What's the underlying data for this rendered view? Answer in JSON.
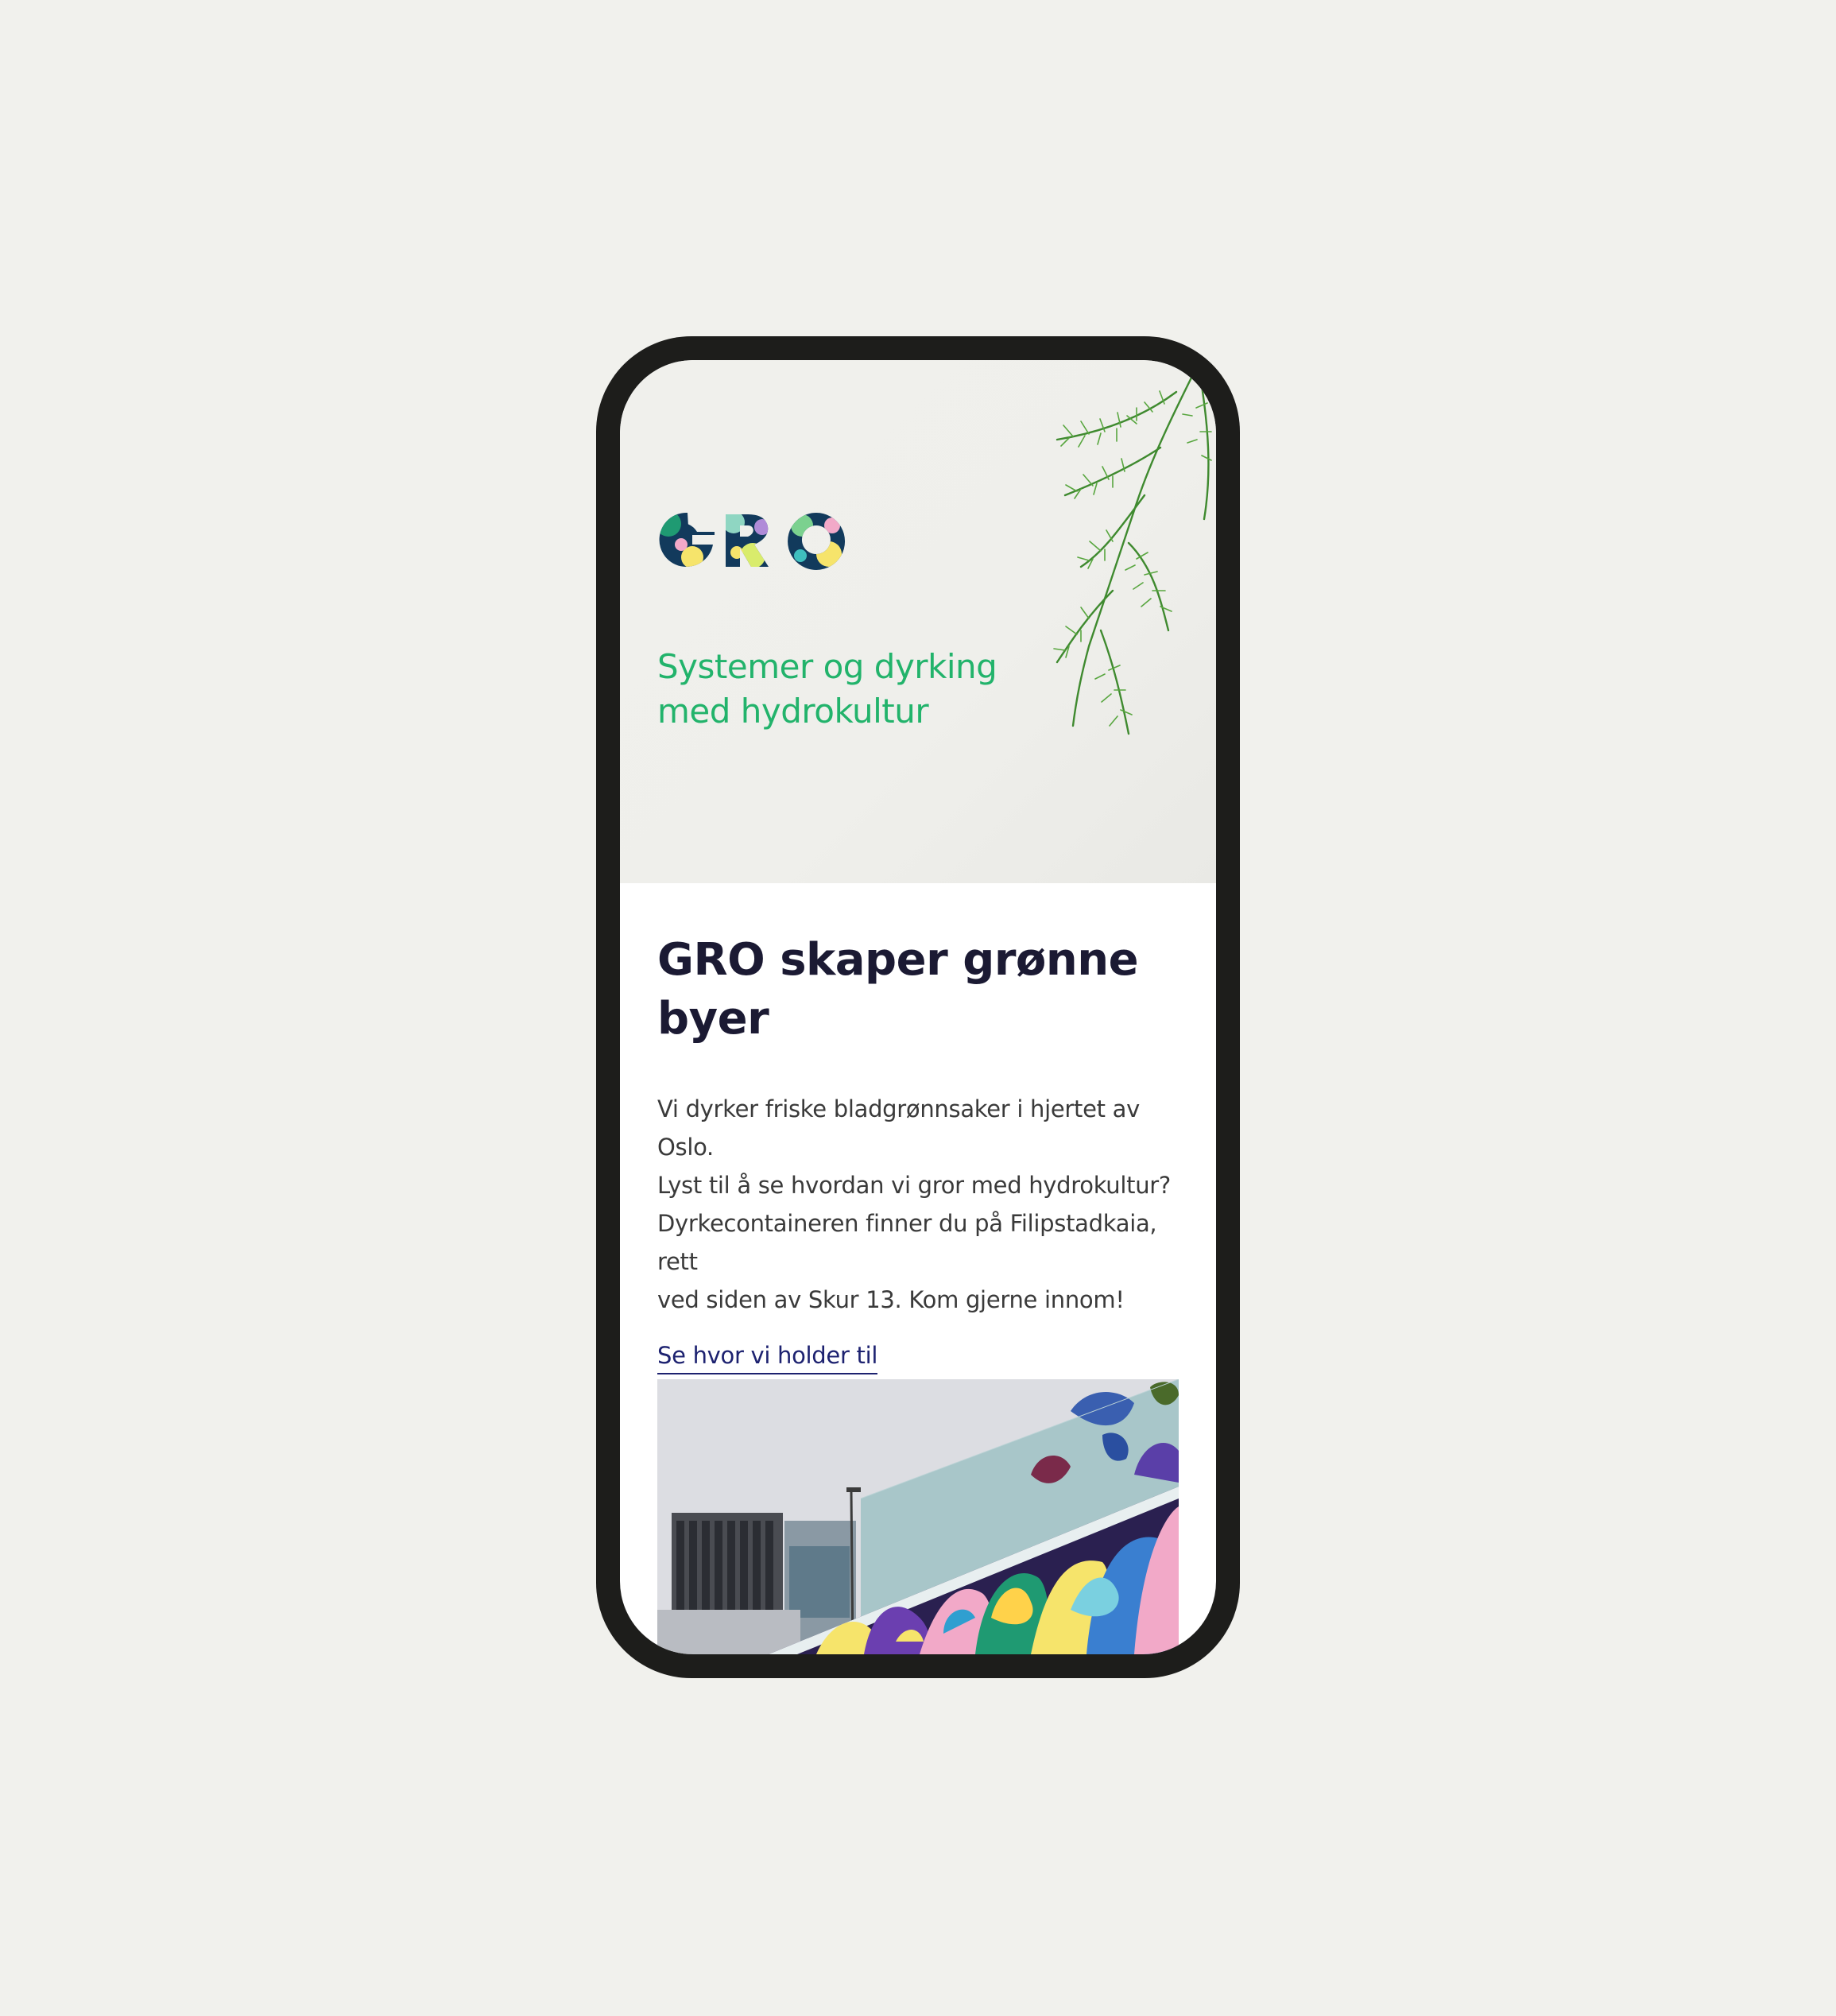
{
  "hero": {
    "logo_text": "GRO",
    "tagline_line1": "Systemer og dyrking",
    "tagline_line2": "med hydrokultur",
    "decor_image": "dill-sprig-photo"
  },
  "main": {
    "headline_line1": "GRO skaper grønne",
    "headline_line2": "byer",
    "body_lines": [
      "Vi dyrker friske bladgrønnsaker i hjertet av Oslo.",
      "Lyst til å se hvordan vi gror med hydrokultur?",
      "Dyrkecontaineren finner du på Filipstadkaia, rett",
      "ved siden av Skur 13. Kom gjerne innom!"
    ],
    "link_label": "Se hvor vi holder til",
    "photo": "container-mural-photo"
  },
  "colors": {
    "background": "#f1f1ed",
    "phone_frame": "#1d1d1b",
    "tagline": "#22b36b",
    "headline": "#1b1a33",
    "link": "#1d2270"
  }
}
